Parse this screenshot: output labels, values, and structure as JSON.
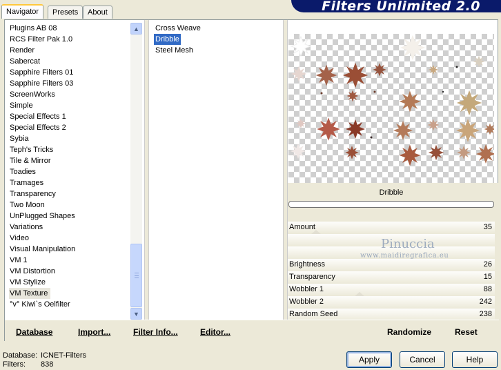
{
  "tabs": [
    {
      "label": "Navigator",
      "active": true
    },
    {
      "label": "Presets",
      "active": false
    },
    {
      "label": "About",
      "active": false
    }
  ],
  "banner": {
    "title": "Filters Unlimited 2.0"
  },
  "categories": [
    {
      "label": "Plugins AB 08"
    },
    {
      "label": "RCS Filter Pak 1.0"
    },
    {
      "label": "Render"
    },
    {
      "label": "Sabercat"
    },
    {
      "label": "Sapphire Filters 01"
    },
    {
      "label": "Sapphire Filters 03"
    },
    {
      "label": "ScreenWorks"
    },
    {
      "label": "Simple"
    },
    {
      "label": "Special Effects 1"
    },
    {
      "label": "Special Effects 2"
    },
    {
      "label": "Sybia"
    },
    {
      "label": "Teph's Tricks"
    },
    {
      "label": "Tile & Mirror"
    },
    {
      "label": "Toadies"
    },
    {
      "label": "Tramages"
    },
    {
      "label": "Transparency"
    },
    {
      "label": "Two Moon"
    },
    {
      "label": "UnPlugged Shapes"
    },
    {
      "label": "Variations"
    },
    {
      "label": "Video"
    },
    {
      "label": "Visual Manipulation"
    },
    {
      "label": "VM 1"
    },
    {
      "label": "VM Distortion"
    },
    {
      "label": "VM Stylize"
    },
    {
      "label": "VM Texture",
      "selected": true
    },
    {
      "label": "°v° Kiwi`s Oelfilter"
    }
  ],
  "filters": [
    {
      "label": "Cross Weave"
    },
    {
      "label": "Dribble",
      "selected": true
    },
    {
      "label": "Steel Mesh"
    }
  ],
  "preview": {
    "filter_name": "Dribble"
  },
  "parameters": [
    {
      "label": "Amount",
      "value": "35",
      "level": 35
    },
    {
      "label": "",
      "value": ""
    },
    {
      "label": "",
      "value": ""
    },
    {
      "label": "Brightness",
      "value": "26",
      "level": 26
    },
    {
      "label": "Transparency",
      "value": "15",
      "level": 15
    },
    {
      "label": "Wobbler 1",
      "value": "88",
      "level": 88
    },
    {
      "label": "Wobbler 2",
      "value": "242",
      "level": 242
    },
    {
      "label": "Random Seed",
      "value": "238",
      "level": 238
    }
  ],
  "watermark": {
    "name": "Pinuccia",
    "url": "www.maidiregrafica.eu"
  },
  "bottom_links": {
    "database_underlined": "D",
    "database_rest": "atabase",
    "import_underlined": "I",
    "import_rest": "mport...",
    "filter_info_underlined": "Filter I",
    "filter_info_rest": "nfo...",
    "editor_underlined": "E",
    "editor_rest": "ditor...",
    "randomize": "Randomize",
    "reset": "Reset"
  },
  "status": {
    "database_label": "Database:",
    "database_value": "ICNET-Filters",
    "filters_label": "Filters:",
    "filters_value": "838"
  },
  "buttons": {
    "apply": "Apply",
    "cancel": "Cancel",
    "help": "Help"
  },
  "colors": {
    "selection": "#316ac5",
    "banner": "#0a1a6a",
    "dialog_bg": "#ece9d8"
  }
}
